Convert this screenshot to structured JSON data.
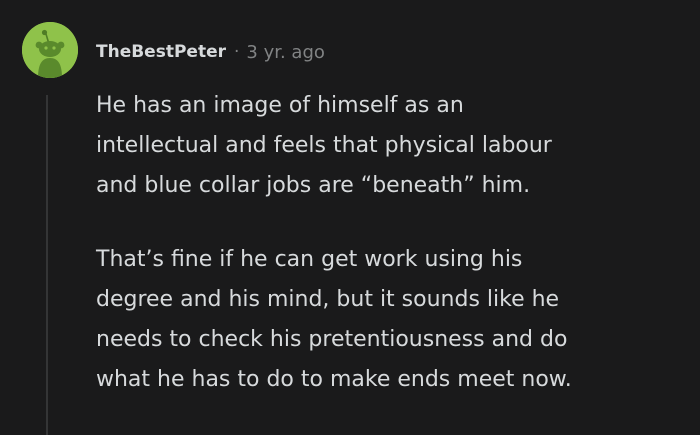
{
  "comment": {
    "username": "TheBestPeter",
    "separator": "·",
    "timestamp": "3 yr. ago",
    "paragraphs": [
      [
        "He has an image of himself as an",
        "intellectual and feels that physical labour",
        "and blue collar jobs are “beneath” him."
      ],
      [
        "That’s fine if he can get work using his",
        "degree and his mind, but it sounds like he",
        "needs to check his pretentiousness and do",
        "what he has to do to make ends meet now."
      ]
    ]
  },
  "avatar": {
    "icon": "snoo-avatar-icon",
    "background": "#8fc24a",
    "figure_color": "#5a8a2c"
  },
  "colors": {
    "background": "#1a1a1b",
    "text": "#d7dadc",
    "meta": "#818384",
    "thread_line": "#343536"
  }
}
